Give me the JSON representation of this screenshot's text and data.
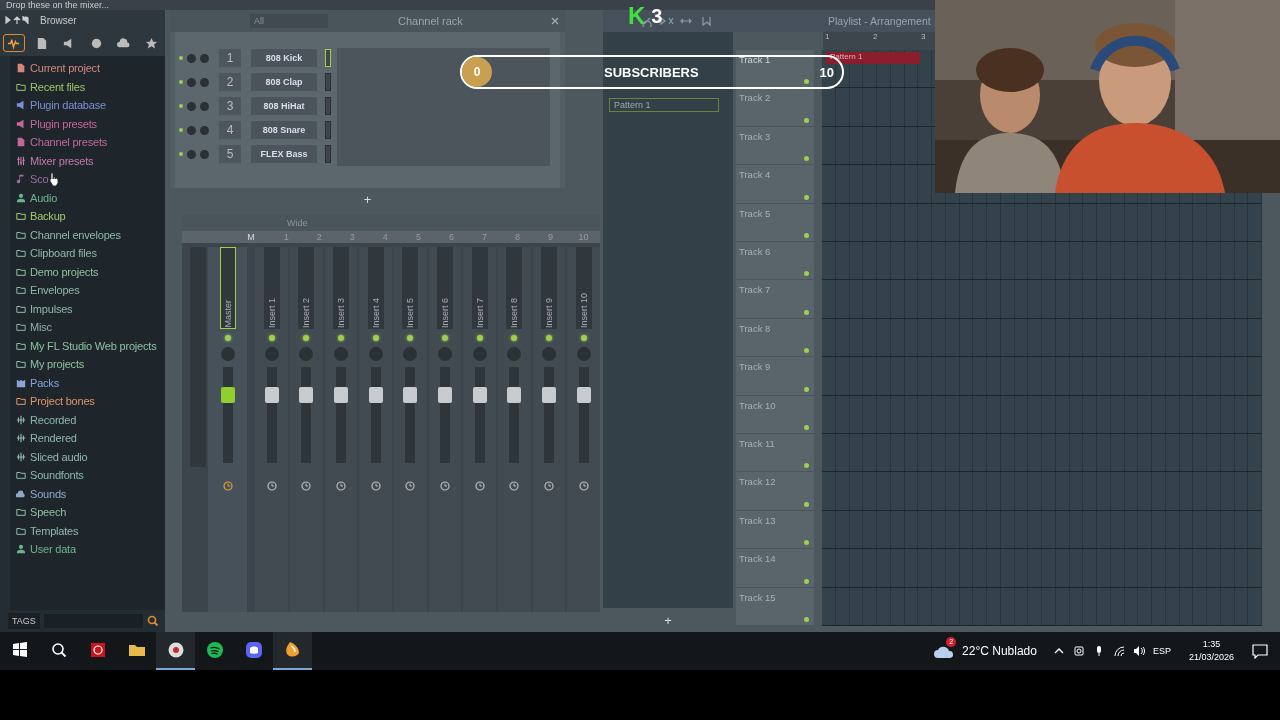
{
  "hint_bar": {
    "text": "Drop these on the mixer..."
  },
  "browser": {
    "title": "Browser",
    "tabs": [
      {
        "kind": "wave",
        "selected": true
      },
      {
        "kind": "doc",
        "selected": false
      },
      {
        "kind": "plug",
        "selected": false
      },
      {
        "kind": "globe",
        "selected": false
      },
      {
        "kind": "cloud",
        "selected": false
      },
      {
        "kind": "star",
        "selected": false
      }
    ],
    "items": [
      {
        "label": "Current project",
        "kind": "doc",
        "color": "#d4877f"
      },
      {
        "label": "Recent files",
        "kind": "folder",
        "color": "#9cc46a"
      },
      {
        "label": "Plugin database",
        "kind": "plug",
        "color": "#7b8fd4"
      },
      {
        "label": "Plugin presets",
        "kind": "plug",
        "color": "#c7669a"
      },
      {
        "label": "Channel presets",
        "kind": "doc",
        "color": "#c0689a"
      },
      {
        "label": "Mixer presets",
        "kind": "sliders",
        "color": "#c27ab0"
      },
      {
        "label": "Sco",
        "kind": "note",
        "color": "#9b6fa0"
      },
      {
        "label": "Audio",
        "kind": "person",
        "color": "#6ab48a"
      },
      {
        "label": "Backup",
        "kind": "folder",
        "color": "#a6c870"
      },
      {
        "label": "Channel envelopes",
        "kind": "folder",
        "color": "#8fb8a8"
      },
      {
        "label": "Clipboard files",
        "kind": "folder",
        "color": "#8fb8a9"
      },
      {
        "label": "Demo projects",
        "kind": "folder",
        "color": "#8fc0a0"
      },
      {
        "label": "Envelopes",
        "kind": "folder",
        "color": "#8fb8aa"
      },
      {
        "label": "Impulses",
        "kind": "folder",
        "color": "#8fb8ab"
      },
      {
        "label": "Misc",
        "kind": "folder",
        "color": "#8fb0a8"
      },
      {
        "label": "My FL Studio Web projects",
        "kind": "folder",
        "color": "#8fc0a1"
      },
      {
        "label": "My projects",
        "kind": "folder",
        "color": "#8fc0a2"
      },
      {
        "label": "Packs",
        "kind": "packs",
        "color": "#8aa4d8"
      },
      {
        "label": "Project bones",
        "kind": "folder",
        "color": "#e0956a"
      },
      {
        "label": "Recorded",
        "kind": "wave",
        "color": "#8fb8ac"
      },
      {
        "label": "Rendered",
        "kind": "wave",
        "color": "#8fb8ad"
      },
      {
        "label": "Sliced audio",
        "kind": "wave",
        "color": "#8fb8ae"
      },
      {
        "label": "Soundfonts",
        "kind": "folder",
        "color": "#8fb8af"
      },
      {
        "label": "Sounds",
        "kind": "cloud",
        "color": "#8fa8c8"
      },
      {
        "label": "Speech",
        "kind": "folder",
        "color": "#8fc0a3"
      },
      {
        "label": "Templates",
        "kind": "folder",
        "color": "#8fb8b0"
      },
      {
        "label": "User data",
        "kind": "person",
        "color": "#6ab48b"
      }
    ],
    "tags": "TAGS"
  },
  "channel_rack": {
    "filter": "All",
    "title": "Channel rack",
    "channels": [
      {
        "number": "1",
        "name": "808 Kick",
        "selected": true
      },
      {
        "number": "2",
        "name": "808 Clap",
        "selected": false
      },
      {
        "number": "3",
        "name": "808 HiHat",
        "selected": false
      },
      {
        "number": "4",
        "name": "808 Snare",
        "selected": false
      },
      {
        "number": "5",
        "name": "FLEX Bass",
        "selected": false
      }
    ],
    "add": "+"
  },
  "mixer": {
    "preset": "Wide",
    "header": [
      "M",
      "1",
      "2",
      "3",
      "4",
      "5",
      "6",
      "7",
      "8",
      "9",
      "10"
    ],
    "tracks": [
      {
        "name": "Master",
        "selected": true,
        "level": 0.75
      },
      {
        "name": "Insert 1",
        "selected": false,
        "level": 0.75
      },
      {
        "name": "Insert 2",
        "selected": false,
        "level": 0.75
      },
      {
        "name": "Insert 3",
        "selected": false,
        "level": 0.75
      },
      {
        "name": "Insert 4",
        "selected": false,
        "level": 0.75
      },
      {
        "name": "Insert 5",
        "selected": false,
        "level": 0.75
      },
      {
        "name": "Insert 6",
        "selected": false,
        "level": 0.75
      },
      {
        "name": "Insert 7",
        "selected": false,
        "level": 0.75
      },
      {
        "name": "Insert 8",
        "selected": false,
        "level": 0.75
      },
      {
        "name": "Insert 9",
        "selected": false,
        "level": 0.75
      },
      {
        "name": "Insert 10",
        "selected": false,
        "level": 0.75
      }
    ]
  },
  "playlist": {
    "title": "Playlist - Arrangement",
    "patterns": [
      "Pattern 1"
    ],
    "add": "+",
    "ruler": [
      "1",
      "2",
      "3"
    ],
    "clip": "Pattern 1",
    "tracks": [
      "Track 1",
      "Track 2",
      "Track 3",
      "Track 4",
      "Track 5",
      "Track 6",
      "Track 7",
      "Track 8",
      "Track 9",
      "Track 10",
      "Track 11",
      "Track 12",
      "Track 13",
      "Track 14",
      "Track 15"
    ]
  },
  "overlay": {
    "logo": "K",
    "count": "3",
    "start": "0",
    "label": "SUBSCRIBERS",
    "goal": "10",
    "level": 0.05
  },
  "taskbar": {
    "apps": [
      {
        "kind": "windows",
        "running": false
      },
      {
        "kind": "search",
        "running": false
      },
      {
        "kind": "recorder",
        "running": false
      },
      {
        "kind": "folder",
        "running": false
      },
      {
        "kind": "browser",
        "running": true
      },
      {
        "kind": "music",
        "running": false
      },
      {
        "kind": "chat",
        "running": false
      },
      {
        "kind": "daw",
        "running": true
      }
    ],
    "weather": {
      "badge": "2",
      "text": "22°C Nublado"
    },
    "language": "ESP",
    "time": "1:35",
    "date": "21/03/2026"
  }
}
